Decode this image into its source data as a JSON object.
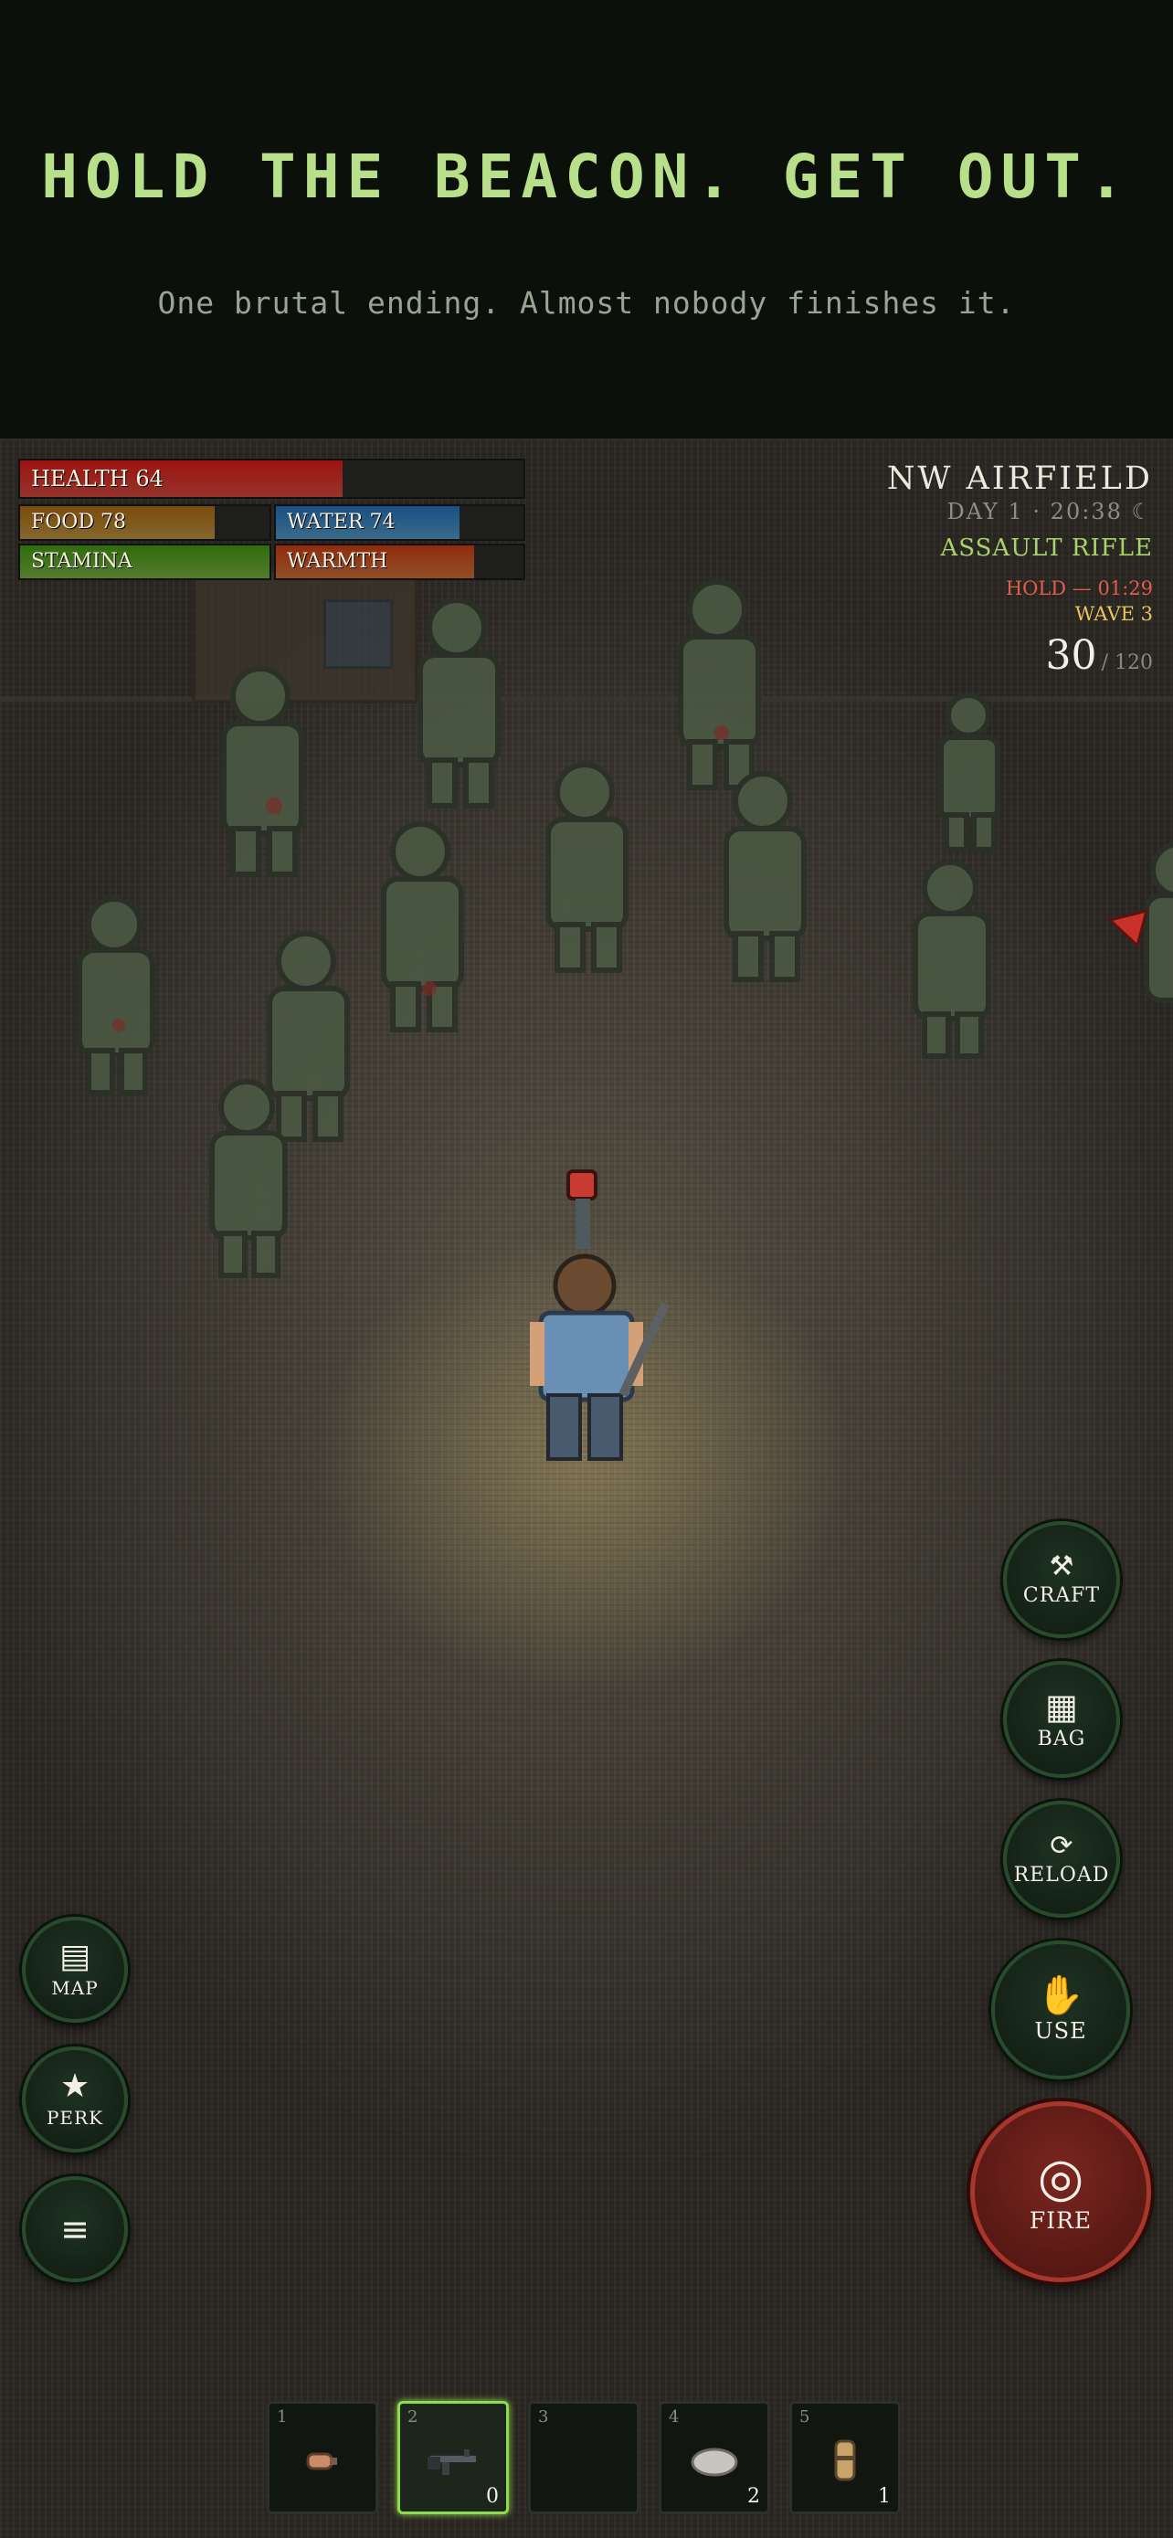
{
  "banner": {
    "headline": "HOLD THE BEACON. GET OUT.",
    "subline": "One brutal ending. Almost nobody finishes it."
  },
  "hud": {
    "health": {
      "label": "HEALTH 64",
      "value": 64,
      "color": "#c8463b"
    },
    "food": {
      "label": "FOOD 78",
      "value": 78,
      "color": "#b08a3c"
    },
    "water": {
      "label": "WATER 74",
      "value": 74,
      "color": "#4e8fb8"
    },
    "stamina": {
      "label": "STAMINA",
      "value": 100,
      "color": "#6fa63c"
    },
    "warmth": {
      "label": "WARMTH",
      "value": 80,
      "color": "#c06a35"
    }
  },
  "info": {
    "location": "NW AIRFIELD",
    "day_time": "DAY 1 · 20:38 ☾",
    "weapon": "ASSAULT RIFLE",
    "hold": "HOLD — 01:29",
    "wave": "WAVE 3",
    "ammo_current": "30",
    "ammo_max": "/ 120"
  },
  "buttons": {
    "craft": {
      "icon": "⚒",
      "label": "CRAFT"
    },
    "bag": {
      "icon": "▦",
      "label": "BAG"
    },
    "reload": {
      "icon": "⟳",
      "label": "RELOAD"
    },
    "use": {
      "icon": "✋",
      "label": "USE"
    },
    "fire": {
      "icon": "◎",
      "label": "FIRE"
    },
    "map": {
      "icon": "▤",
      "label": "MAP"
    },
    "perk": {
      "icon": "★",
      "label": "PERK"
    },
    "menu": {
      "icon": "≡"
    }
  },
  "hotbar": [
    {
      "num": "1",
      "icon": "fist-icon",
      "count": ""
    },
    {
      "num": "2",
      "icon": "rifle-icon",
      "count": "0",
      "selected": true
    },
    {
      "num": "3",
      "icon": "",
      "count": ""
    },
    {
      "num": "4",
      "icon": "rock-icon",
      "count": "2"
    },
    {
      "num": "5",
      "icon": "canteen-icon",
      "count": "1"
    }
  ]
}
